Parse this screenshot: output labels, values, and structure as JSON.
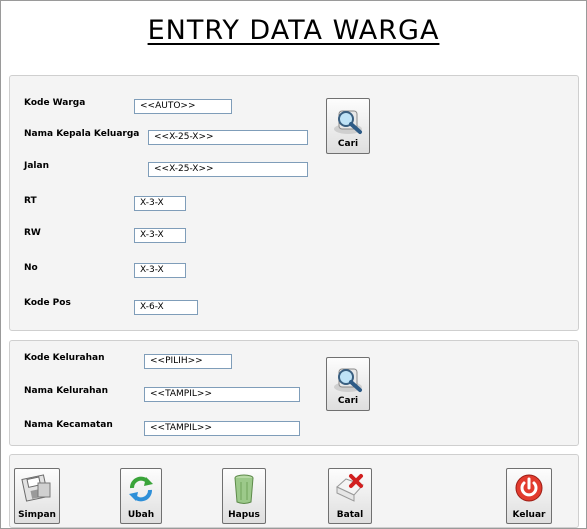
{
  "title": "ENTRY DATA WARGA",
  "warga": {
    "kode_warga_label": "Kode Warga",
    "kode_warga_value": "<<AUTO>>",
    "nama_kk_label": "Nama Kepala Keluarga",
    "nama_kk_value": "<<X-25-X>>",
    "jalan_label": "Jalan",
    "jalan_value": "<<X-25-X>>",
    "rt_label": "RT",
    "rt_value": "X-3-X",
    "rw_label": "RW",
    "rw_value": "X-3-X",
    "no_label": "No",
    "no_value": "X-3-X",
    "kode_pos_label": "Kode Pos",
    "kode_pos_value": "X-6-X",
    "cari_label": "Cari"
  },
  "kelurahan": {
    "kode_label": "Kode Kelurahan",
    "kode_value": "<<PILIH>>",
    "nama_label": "Nama Kelurahan",
    "nama_value": "<<TAMPIL>>",
    "kecamatan_label": "Nama Kecamatan",
    "kecamatan_value": "<<TAMPIL>>",
    "cari_label": "Cari"
  },
  "actions": {
    "simpan": "Simpan",
    "ubah": "Ubah",
    "hapus": "Hapus",
    "batal": "Batal",
    "keluar": "Keluar"
  },
  "icons": {
    "search": "search-icon",
    "save": "floppy-save-icon",
    "refresh": "refresh-icon",
    "delete": "trash-icon",
    "cancel": "cancel-icon",
    "power": "power-icon"
  }
}
